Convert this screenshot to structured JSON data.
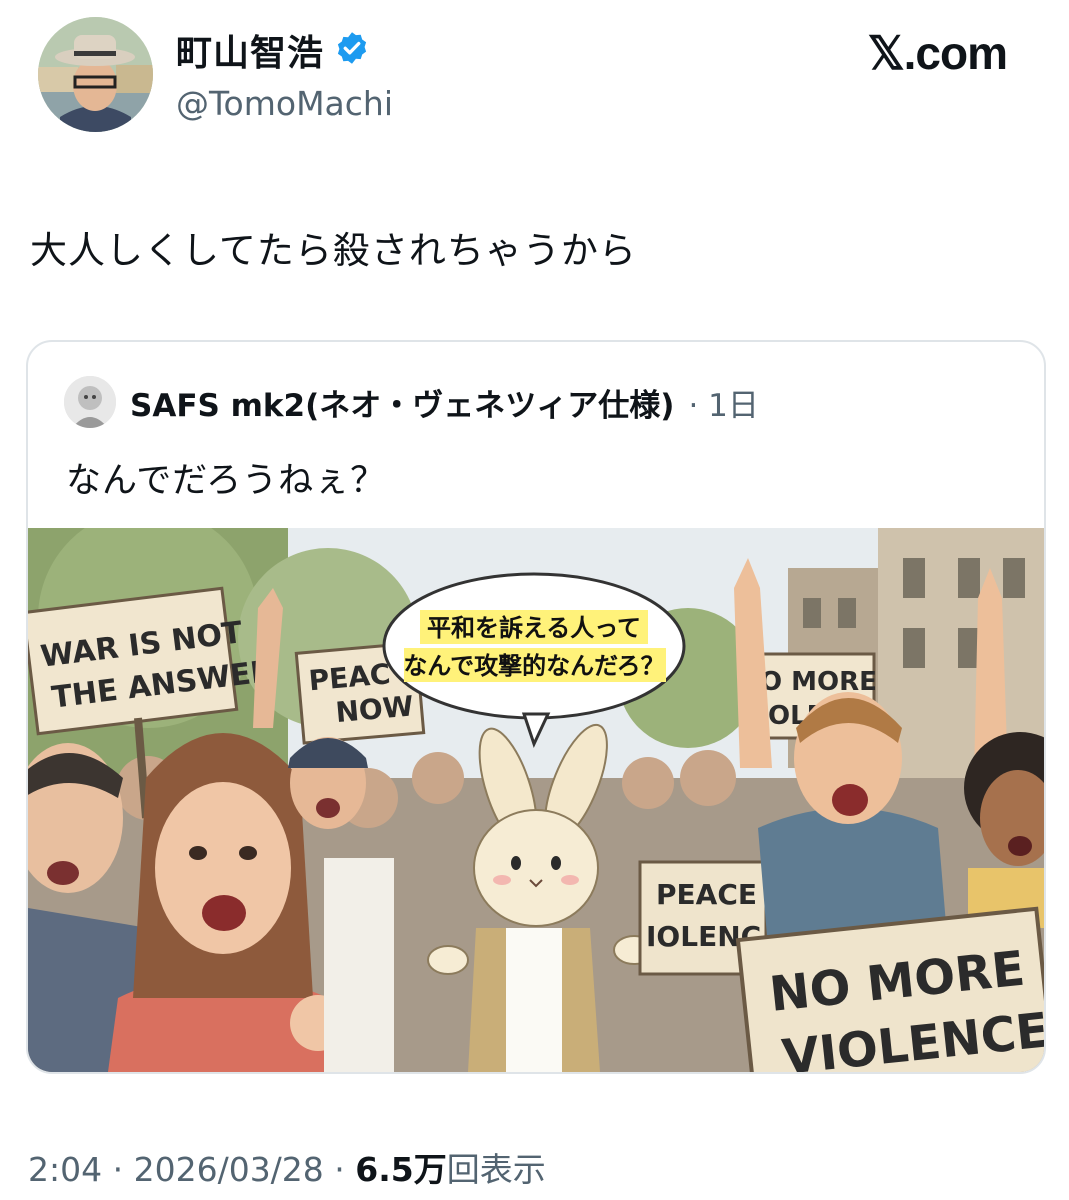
{
  "author": {
    "name": "町山智浩",
    "handle": "@TomoMachi",
    "verified": true
  },
  "brand": "𝕏.com",
  "tweet": {
    "text": "大人しくしてたら殺されちゃうから"
  },
  "quoted": {
    "name": "SAFS mk2(ネオ・ヴェネツィア仕様)",
    "time": "· 1日",
    "text": "なんでだろうねぇ？",
    "image": {
      "speech_line1": "平和を訴える人って",
      "speech_line2": "なんで攻撃的なんだろ？",
      "signs": {
        "war1": "WAR IS NOT",
        "war2": "THE ANSWER",
        "peacenow1": "PEAC",
        "peacenow2": "NOW",
        "nomore_small1": "O MORE",
        "nomore_small2": "OLEN",
        "peace1": "PEACE",
        "peace2": "IOLENC",
        "nomore_big1": "NO MORE",
        "nomore_big2": "VIOLENCE"
      }
    }
  },
  "meta": {
    "time": "2:04",
    "sep1": " · ",
    "date": "2026/03/28",
    "sep2": " · ",
    "views": "6.5万",
    "views_suffix": "回表示"
  },
  "colors": {
    "verified": "#1d9bf0",
    "muted": "#536471",
    "text": "#0f1419"
  }
}
